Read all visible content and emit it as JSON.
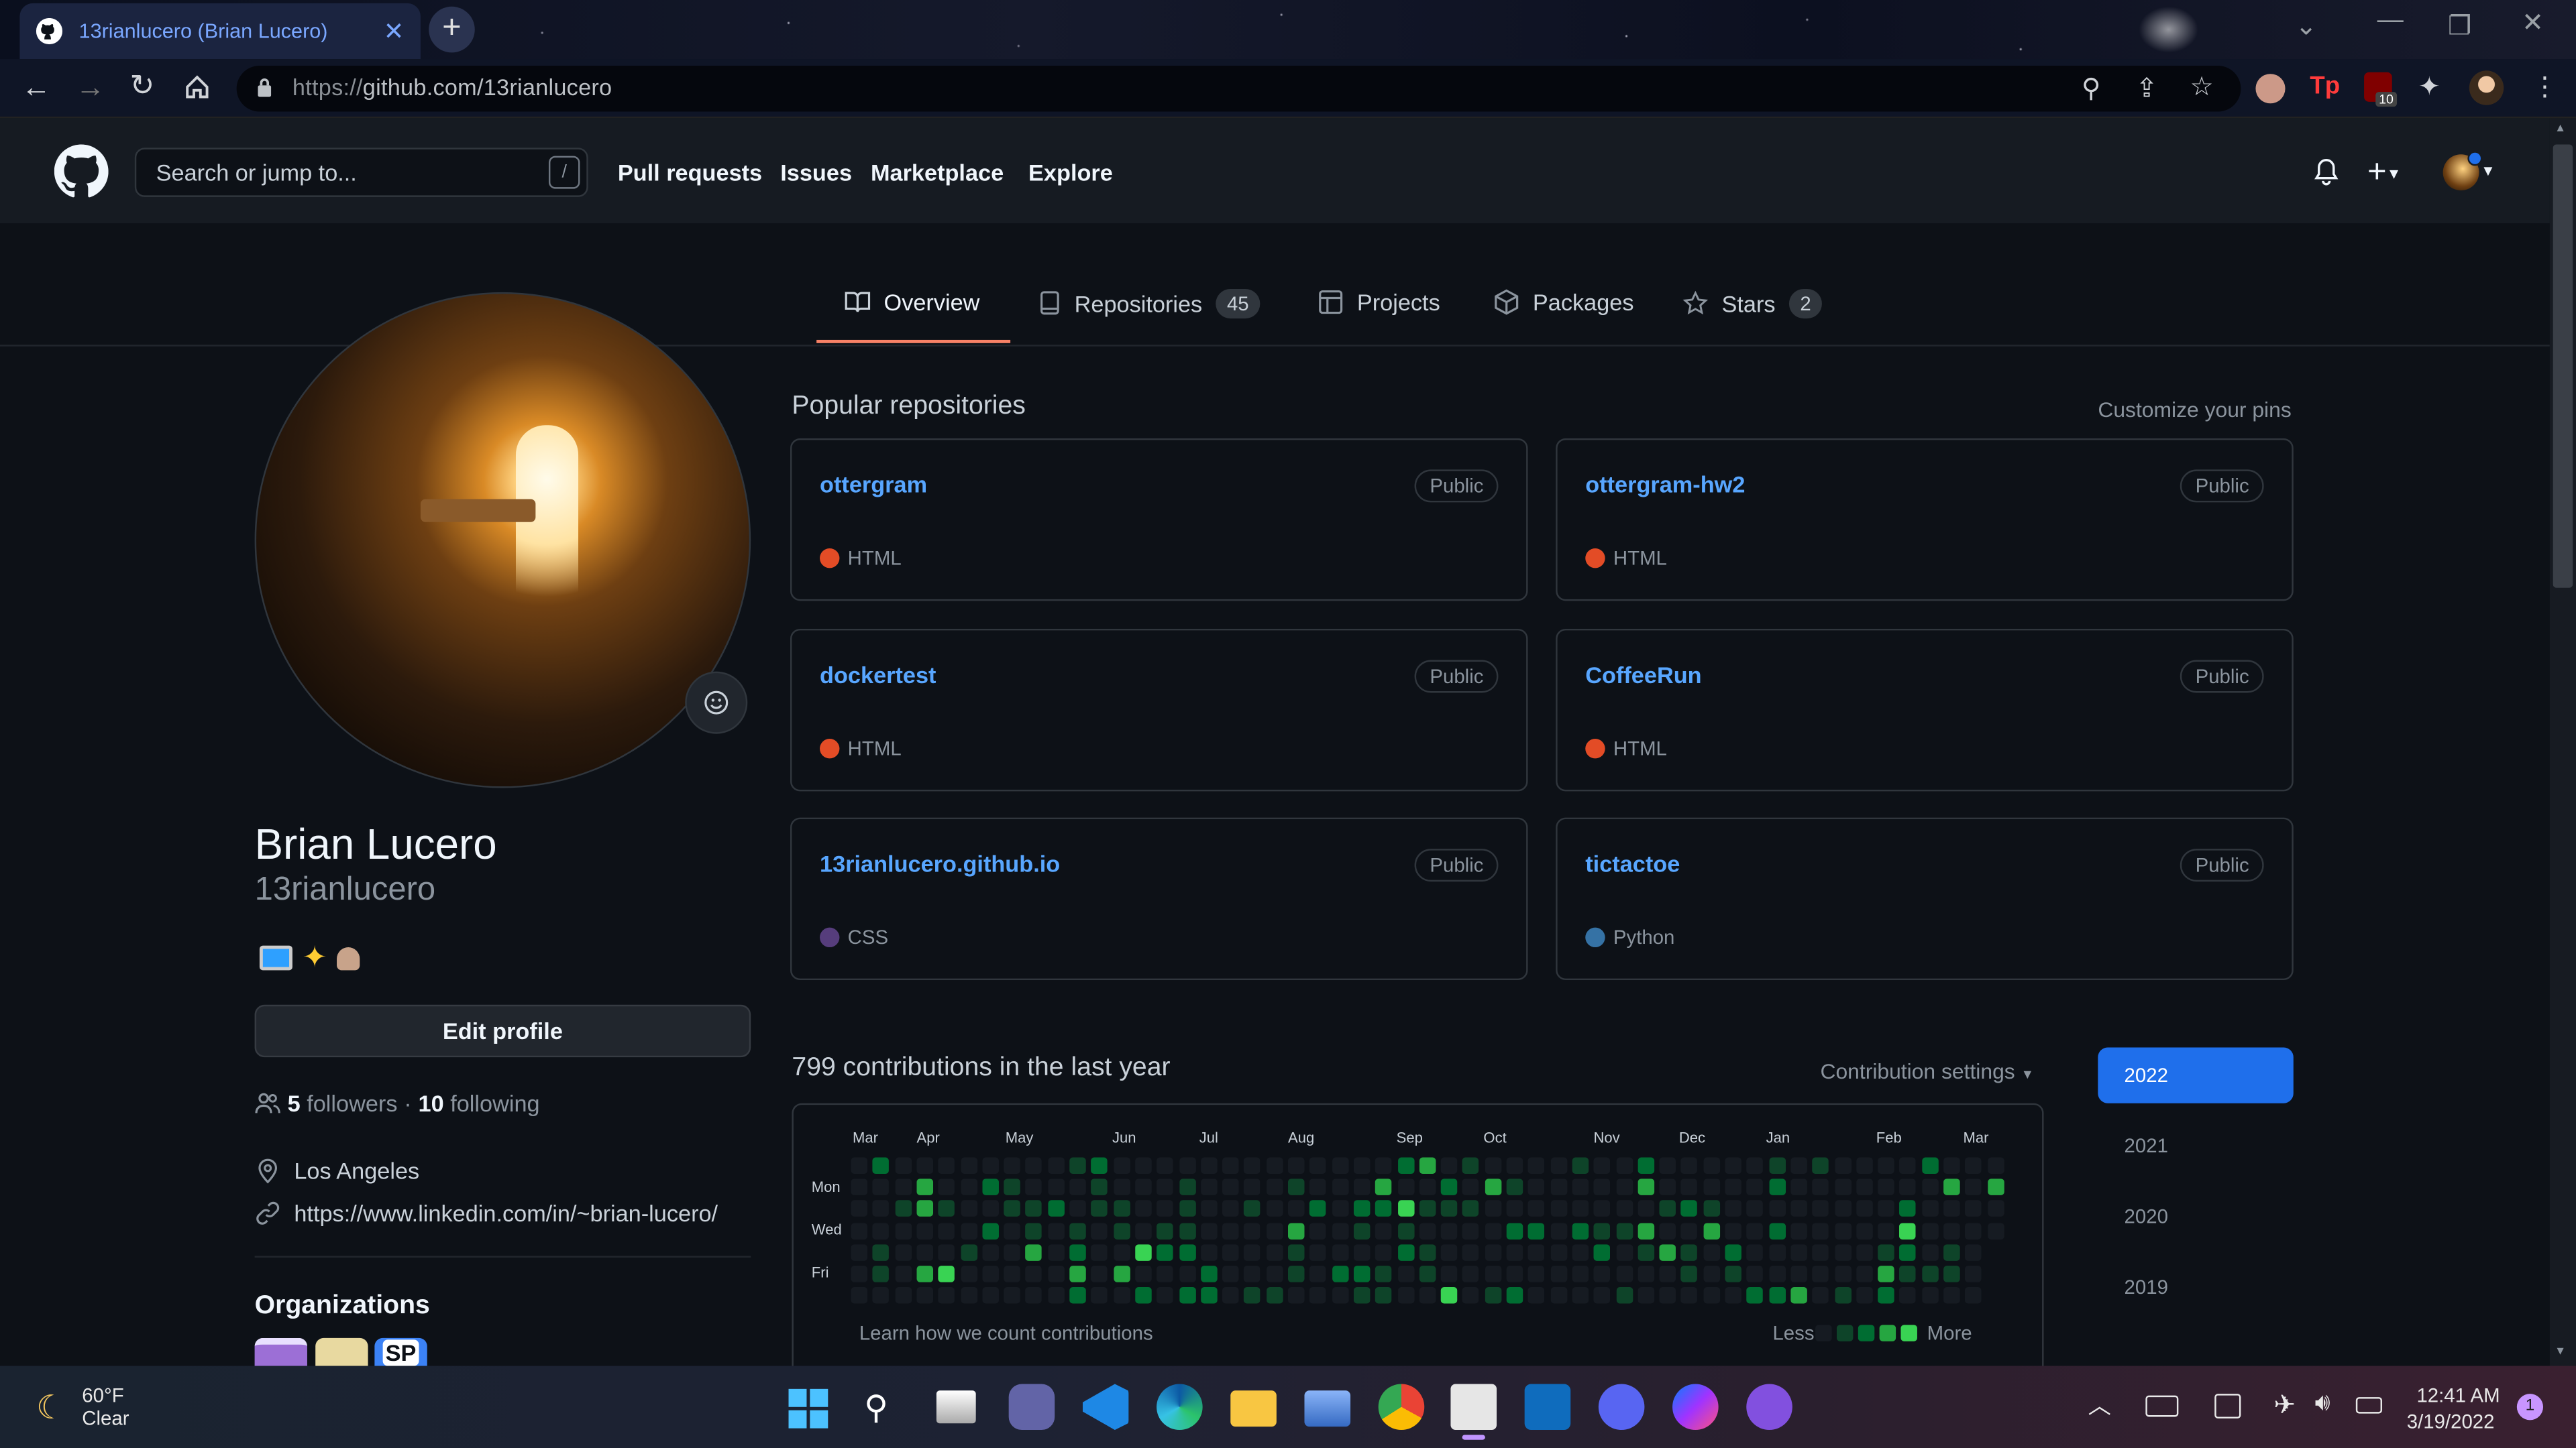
{
  "browser": {
    "tab_title": "13rianlucero (Brian Lucero)",
    "url": "https://github.com/13rianlucero",
    "url_domain": "github.com/13rianlucero",
    "url_scheme": "https://",
    "ext_badge": "10"
  },
  "github": {
    "search_placeholder": "Search or jump to...",
    "search_key": "/",
    "nav": [
      "Pull requests",
      "Issues",
      "Marketplace",
      "Explore"
    ],
    "tabs": [
      {
        "label": "Overview",
        "count": ""
      },
      {
        "label": "Repositories",
        "count": "45"
      },
      {
        "label": "Projects",
        "count": ""
      },
      {
        "label": "Packages",
        "count": ""
      },
      {
        "label": "Stars",
        "count": "2"
      }
    ]
  },
  "profile": {
    "name": "Brian Lucero",
    "login": "13rianlucero",
    "edit_button": "Edit profile",
    "followers_count": "5",
    "followers_label": "followers",
    "sep": "·",
    "following_count": "10",
    "following_label": "following",
    "location": "Los Angeles",
    "website": "https://www.linkedin.com/in/~brian-lucero/",
    "organizations_title": "Organizations",
    "org_text": "SP"
  },
  "popular": {
    "title": "Popular repositories",
    "customize": "Customize your pins",
    "repos": [
      {
        "name": "ottergram",
        "visibility": "Public",
        "language": "HTML",
        "color": "#e34c26"
      },
      {
        "name": "ottergram-hw2",
        "visibility": "Public",
        "language": "HTML",
        "color": "#e34c26"
      },
      {
        "name": "dockertest",
        "visibility": "Public",
        "language": "HTML",
        "color": "#e34c26"
      },
      {
        "name": "CoffeeRun",
        "visibility": "Public",
        "language": "HTML",
        "color": "#e34c26"
      },
      {
        "name": "13rianlucero.github.io",
        "visibility": "Public",
        "language": "CSS",
        "color": "#563d7c"
      },
      {
        "name": "tictactoe",
        "visibility": "Public",
        "language": "Python",
        "color": "#3572a5"
      }
    ]
  },
  "contributions": {
    "title": "799 contributions in the last year",
    "settings": "Contribution settings",
    "months": [
      "Mar",
      "Apr",
      "May",
      "Jun",
      "Jul",
      "Aug",
      "Sep",
      "Oct",
      "Nov",
      "Dec",
      "Jan",
      "Feb",
      "Mar"
    ],
    "days": [
      "Mon",
      "Wed",
      "Fri"
    ],
    "learn": "Learn how we count contributions",
    "less": "Less",
    "more": "More",
    "years": [
      "2022",
      "2021",
      "2020",
      "2019"
    ],
    "selected_year": "2022"
  },
  "taskbar": {
    "temp": "60°F",
    "weather": "Clear",
    "time": "12:41 AM",
    "date": "3/19/2022",
    "notifications": "1"
  },
  "colors": {
    "bg": "#0d1117",
    "header": "#161b22",
    "link": "#58a6ff",
    "accent_underline": "#f78166",
    "year_selected": "#1f6feb"
  }
}
